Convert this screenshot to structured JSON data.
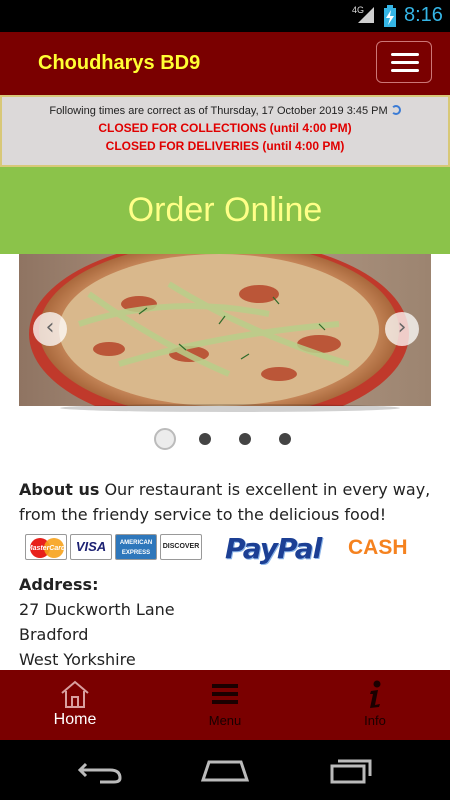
{
  "status_bar": {
    "network": "4G",
    "clock": "8:16"
  },
  "header": {
    "title": "Choudharys BD9",
    "menu_icon": "hamburger-menu-icon"
  },
  "notice": {
    "times_line": "Following times are correct as of Thursday, 17 October 2019 3:45 PM",
    "collections": "CLOSED FOR COLLECTIONS (until 4:00 PM)",
    "deliveries": "CLOSED FOR DELIVERIES (until 4:00 PM)",
    "refresh_icon": "refresh-icon"
  },
  "order_band": {
    "label": "Order Online"
  },
  "carousel": {
    "prev_icon": "chevron-left-icon",
    "next_icon": "chevron-right-icon",
    "slide_count": 4,
    "active_index": 0
  },
  "about": {
    "heading": "About us",
    "text": " Our restaurant is excellent in every way, from the friendy service to the delicious food!"
  },
  "payments": {
    "cards": [
      "MasterCard",
      "VISA",
      "AMERICAN EXPRESS",
      "DISCOVER"
    ],
    "paypal": "PayPal",
    "cash": "CASH"
  },
  "address": {
    "label": "Address:",
    "lines": [
      "27 Duckworth Lane",
      "Bradford",
      "West Yorkshire"
    ]
  },
  "bottom_nav": {
    "items": [
      {
        "label": "Home",
        "icon": "home-icon"
      },
      {
        "label": "Menu",
        "icon": "menu-icon"
      },
      {
        "label": "Info",
        "icon": "info-icon"
      }
    ],
    "active": "Home"
  },
  "colors": {
    "header_bg": "#7a0000",
    "title": "#ffff33",
    "order_band_bg": "#8bc34a",
    "order_text": "#ffff88",
    "closed_text": "#e00000",
    "clock": "#35b5e5"
  }
}
